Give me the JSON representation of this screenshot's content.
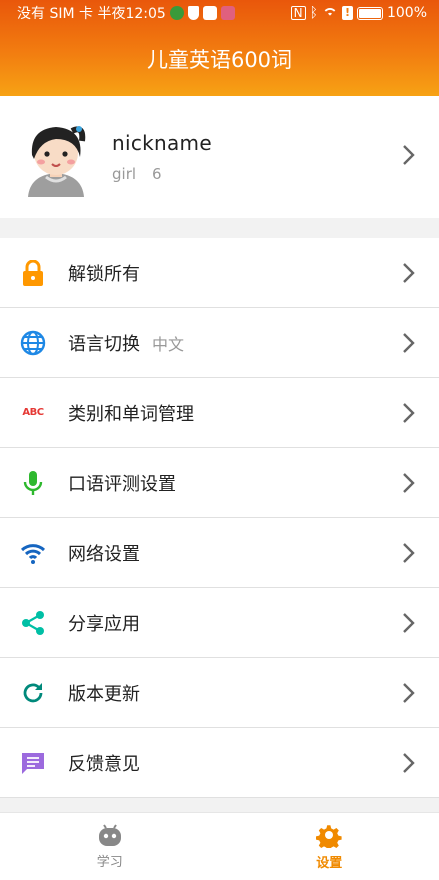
{
  "status": {
    "carrier": "没有 SIM 卡 半夜12:05",
    "battery": "100%"
  },
  "header": {
    "title": "儿童英语600词"
  },
  "profile": {
    "nickname": "nickname",
    "gender": "girl",
    "age": "6"
  },
  "menu": [
    {
      "label": "解锁所有",
      "icon": "lock-icon",
      "color": "#ff9800"
    },
    {
      "label": "语言切换",
      "extra": "中文",
      "icon": "globe-icon",
      "color": "#1e88e5"
    },
    {
      "label": "类别和单词管理",
      "icon": "abc-icon",
      "color": "#e53935"
    },
    {
      "label": "口语评测设置",
      "icon": "microphone-icon",
      "color": "#2eb82e"
    },
    {
      "label": "网络设置",
      "icon": "wifi-icon",
      "color": "#1565c0"
    },
    {
      "label": "分享应用",
      "icon": "share-icon",
      "color": "#00bfa5"
    },
    {
      "label": "版本更新",
      "icon": "refresh-icon",
      "color": "#00897b"
    },
    {
      "label": "反馈意见",
      "icon": "feedback-icon",
      "color": "#9c6ade"
    }
  ],
  "tabs": [
    {
      "label": "学习",
      "icon": "android-icon",
      "active": false
    },
    {
      "label": "设置",
      "icon": "gear-icon",
      "active": true
    }
  ],
  "colors": {
    "accent": "#f08a00",
    "header_top": "#e9570b",
    "header_bottom": "#f7a214"
  }
}
